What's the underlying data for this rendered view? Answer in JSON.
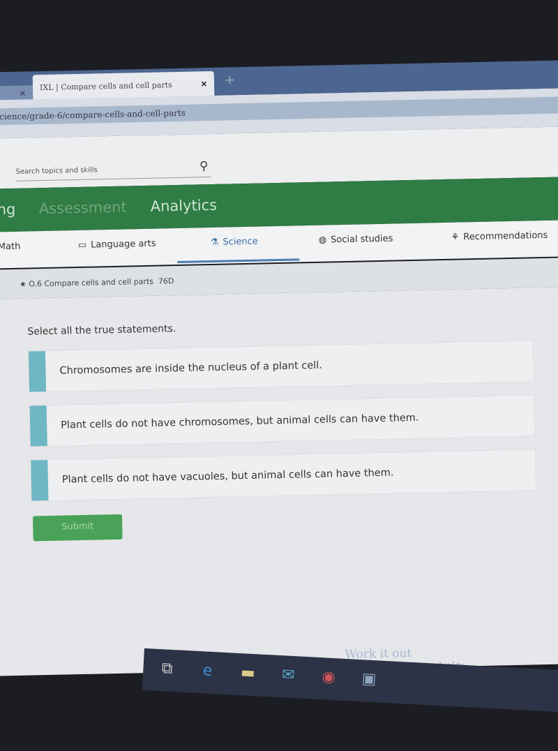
{
  "browser": {
    "tab_title": "IXL | Compare cells and cell parts",
    "url": "science/grade-6/compare-cells-and-cell-parts",
    "new_tab": "+",
    "close": "✕"
  },
  "header": {
    "search_placeholder": "Search topics and skills"
  },
  "nav": {
    "items": [
      "ng",
      "Assessment",
      "Analytics"
    ]
  },
  "subjects": {
    "items": [
      "Math",
      "Language arts",
      "Science",
      "Social studies",
      "Recommendations"
    ],
    "active": "Science"
  },
  "breadcrumb": {
    "skill": "O.6 Compare cells and cell parts",
    "code": "76D"
  },
  "question": {
    "prompt": "Select all the true statements.",
    "options": [
      "Chromosomes are inside the nucleus of a plant cell.",
      "Plant cells do not have chromosomes, but animal cells can have them.",
      "Plant cells do not have vacuoles, but animal cells can have them."
    ],
    "submit": "Submit"
  },
  "help": {
    "work_it_out": "Work it out",
    "not_ready": "Not feeling ready yet? These can help:"
  },
  "colors": {
    "green": "#2f7c44",
    "checkbox": "#6fb7c5",
    "submit": "#49a257"
  }
}
